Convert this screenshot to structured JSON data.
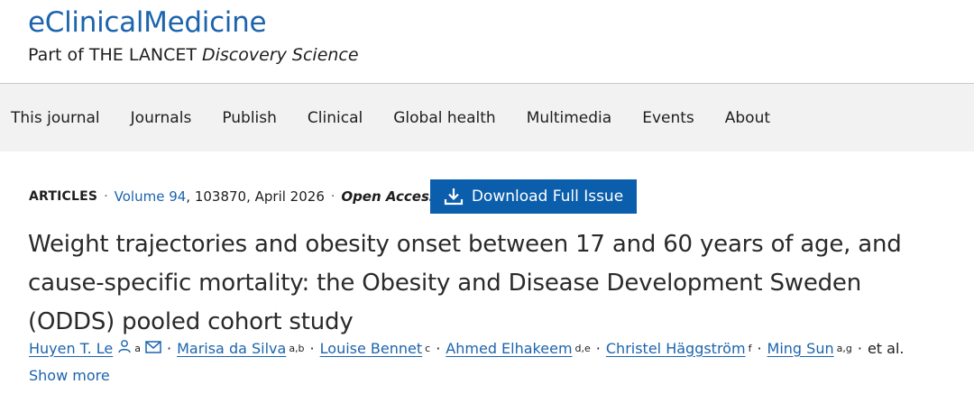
{
  "brand": {
    "title": "eClinicalMedicine",
    "sub_prefix": "Part of THE LANCET",
    "sub_italic": "Discovery Science"
  },
  "nav": {
    "items": [
      {
        "label": "This journal"
      },
      {
        "label": "Journals"
      },
      {
        "label": "Publish"
      },
      {
        "label": "Clinical"
      },
      {
        "label": "Global health"
      },
      {
        "label": "Multimedia"
      },
      {
        "label": "Events"
      },
      {
        "label": "About"
      }
    ]
  },
  "article": {
    "kind": "ARTICLES",
    "volume": "Volume 94",
    "details": ", 103870, April 2026",
    "open_access": "Open Access",
    "download_label": "Download Full Issue",
    "title": "Weight trajectories and obesity onset between 17 and 60 years of age, and cause-specific mortality: the Obesity and Disease Development Sweden (ODDS) pooled cohort study",
    "authors": [
      {
        "name": "Huyen T. Le",
        "sup": "a"
      },
      {
        "name": "Marisa da Silva",
        "sup": "a,b"
      },
      {
        "name": "Louise Bennet",
        "sup": "c"
      },
      {
        "name": "Ahmed Elhakeem",
        "sup": "d,e"
      },
      {
        "name": "Christel Häggström",
        "sup": "f"
      },
      {
        "name": "Ming Sun",
        "sup": "a,g"
      }
    ],
    "et_al": "et al.",
    "show_more": "Show more"
  },
  "colors": {
    "brand_blue": "#1c64ad",
    "button_blue": "#0b5eab",
    "nav_bg": "#f2f2f2"
  },
  "icons": {
    "person": "person-icon",
    "email": "envelope-icon",
    "download": "download-icon"
  }
}
